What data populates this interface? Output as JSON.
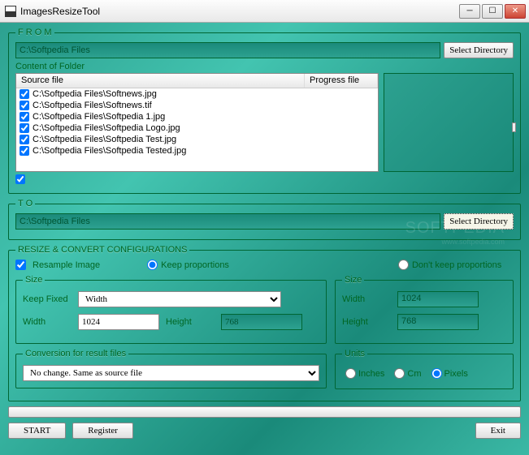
{
  "window": {
    "title": "ImagesResizeTool"
  },
  "from": {
    "legend": "F R O M",
    "path": "C:\\Softpedia Files",
    "select_btn": "Select Directory",
    "content_label": "Content of Folder",
    "col_source": "Source file",
    "col_progress": "Progress file",
    "files": [
      "C:\\Softpedia Files\\Softnews.jpg",
      "C:\\Softpedia Files\\Softnews.tif",
      "C:\\Softpedia Files\\Softpedia 1.jpg",
      "C:\\Softpedia Files\\Softpedia Logo.jpg",
      "C:\\Softpedia Files\\Softpedia Test.jpg",
      "C:\\Softpedia Files\\Softpedia Tested.jpg"
    ]
  },
  "to": {
    "legend": "T O",
    "path": "C:\\Softpedia Files",
    "select_btn": "Select Directory"
  },
  "config": {
    "legend": "RESIZE & CONVERT CONFIGURATIONS",
    "resample": "Resample Image",
    "keep_prop": "Keep proportions",
    "dont_keep": "Don't keep proportions",
    "size_legend": "Size",
    "keep_fixed": "Keep Fixed",
    "keep_fixed_val": "Width",
    "width_label": "Width",
    "width_val": "1024",
    "height_label": "Height",
    "height_val": "768",
    "right_width_label": "Width",
    "right_width_val": "1024",
    "right_height_label": "Height",
    "right_height_val": "768",
    "conv_legend": "Conversion for result files",
    "conv_val": "No change. Same as source file",
    "units_legend": "Units",
    "unit_inches": "Inches",
    "unit_cm": "Cm",
    "unit_px": "Pixels"
  },
  "buttons": {
    "start": "START",
    "register": "Register",
    "exit": "Exit"
  }
}
